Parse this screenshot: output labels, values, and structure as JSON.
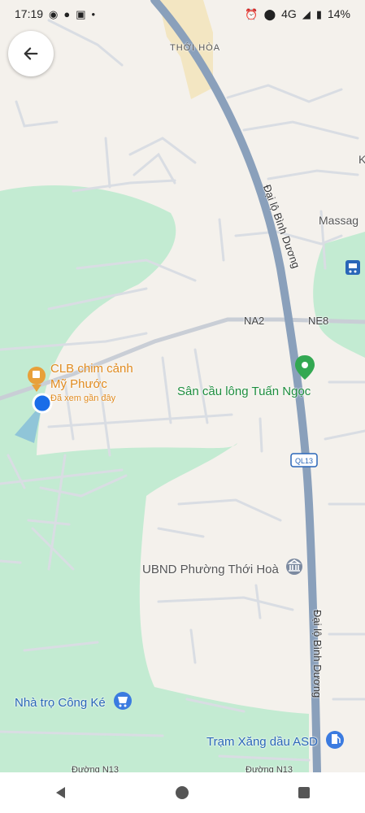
{
  "status_bar": {
    "time": "17:19",
    "left_icons": [
      "messenger-icon",
      "chat-icon",
      "facebook-icon",
      "dot-icon"
    ],
    "right_icons": [
      "alarm-icon",
      "location-icon"
    ],
    "network": "4G",
    "battery": "14%"
  },
  "map": {
    "area_label": "THỚI HÒA",
    "highway_label_north": "Đại lộ Bình Dương",
    "highway_label_south": "Đại lộ Bình Dương",
    "road_na2": "NA2",
    "road_ne8": "NE8",
    "route_shield": "QL13",
    "massage_label": "Massag",
    "edge_letter": "K",
    "bottom_road_left": "Đường N13",
    "bottom_road_right": "Đường N13"
  },
  "places": {
    "club_name_line1": "CLB chim cảnh",
    "club_name_line2": "Mỹ Phước",
    "club_subtitle": "Đã xem gần đây",
    "badminton": "Sân cầu lông Tuấn Ngọc",
    "ubnd": "UBND Phường Thới Hoà",
    "guesthouse": "Nhà trọ Công Ké",
    "gas_station": "Trạm Xăng dầu ASD"
  },
  "colors": {
    "land": "#f4f1ec",
    "park": "#c3ebd2",
    "highway": "#8aa0bb",
    "road": "#d9dde3",
    "orange_pin": "#e8a03a",
    "green_pin": "#33a852",
    "blue_dot": "#1a6de8"
  }
}
